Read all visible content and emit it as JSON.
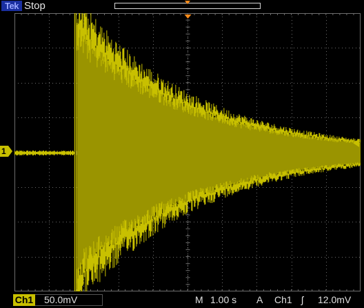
{
  "header": {
    "brand": "Tek",
    "acquisition_status": "Stop"
  },
  "channel": {
    "marker_label": "1",
    "name": "Ch1",
    "vertical_scale": "50.0mV"
  },
  "timebase": {
    "label": "M",
    "value": "1.00 s"
  },
  "trigger": {
    "mode": "A",
    "source": "Ch1",
    "slope_symbol": "ʃ",
    "level": "12.0mV"
  },
  "colors": {
    "trace": "#c8c000",
    "trace_fill": "#9a9400",
    "grid": "#6e6e6e",
    "marker_orange": "#ff8c1a",
    "background": "#000000"
  },
  "waveform": {
    "description_type": "decaying-oscillation-envelope",
    "divisions_horizontal": 10,
    "divisions_vertical": 8,
    "onset_division": 1.8,
    "peak_amplitude_div": 4,
    "decay_end_amplitude_div": 0.35,
    "baseline_noise_div": 0.05
  }
}
